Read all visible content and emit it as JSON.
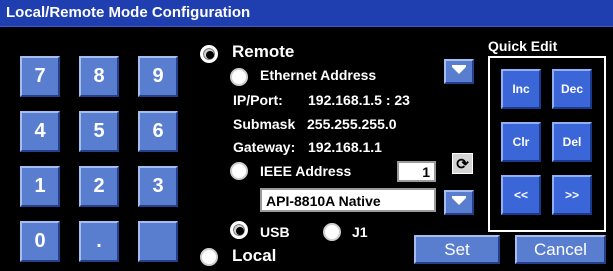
{
  "window": {
    "title": "Local/Remote Mode Configuration"
  },
  "keypad": {
    "keys": [
      "7",
      "8",
      "9",
      "4",
      "5",
      "6",
      "1",
      "2",
      "3",
      "0",
      ".",
      ""
    ]
  },
  "remote": {
    "label": "Remote",
    "selected": true,
    "ethernet": {
      "label": "Ethernet Address",
      "ipport_label": "IP/Port:",
      "ipport_value": "192.168.1.5 : 23",
      "submask_label": "Submask",
      "submask_value": "255.255.255.0",
      "gateway_label": "Gateway:",
      "gateway_value": "192.168.1.1"
    },
    "ieee": {
      "label": "IEEE Address",
      "value": "1",
      "refresh_icon": "refresh-icon",
      "protocol_value": "API-8810A Native"
    },
    "usb_label": "USB",
    "j1_label": "J1"
  },
  "local": {
    "label": "Local"
  },
  "quick_edit": {
    "title": "Quick Edit",
    "buttons": [
      "Inc",
      "Dec",
      "Clr",
      "Del",
      "<<",
      ">>"
    ]
  },
  "actions": {
    "set_label": "Set",
    "cancel_label": "Cancel"
  },
  "colors": {
    "title_bar": "#1f3fb0",
    "key_face": "#5a7ecf",
    "quick_edit_face": "#3a66d8",
    "background": "#000000"
  }
}
